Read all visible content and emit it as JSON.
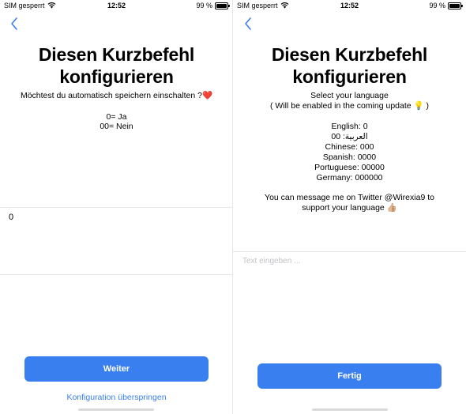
{
  "left": {
    "status": {
      "carrier": "SIM gesperrt",
      "time": "12:52",
      "battery": "99 %",
      "battery_level": 0.99
    },
    "back_icon": "chevron-left-icon",
    "title_line1": "Diesen Kurzbefehl",
    "title_line2": "konfigurieren",
    "question": "Möchtest du automatisch speichern einschalten ?",
    "question_emoji": "❤️",
    "option_yes": "0= Ja",
    "option_no": "00= Nein",
    "input_value": "0",
    "primary_button": "Weiter",
    "skip_link": "Konfiguration überspringen"
  },
  "right": {
    "status": {
      "carrier": "SIM gesperrt",
      "time": "12:52",
      "battery": "99 %",
      "battery_level": 0.99
    },
    "back_icon": "chevron-left-icon",
    "title_line1": "Diesen Kurzbefehl",
    "title_line2": "konfigurieren",
    "select_language": "Select your language",
    "coming_update": "( Will be enabled in the coming update 💡 )",
    "languages": [
      "English: 0",
      "العربية: 00",
      "Chinese: 000",
      "Spanish: 0000",
      "Portuguese: 00000",
      "Germany: 000000"
    ],
    "message_line1": "You can message me on Twitter @Wirexia9 to",
    "message_line2": "support your language 👍🏼",
    "input_placeholder": "Text eingeben ...",
    "primary_button": "Fertig"
  },
  "colors": {
    "accent": "#3a7ff0",
    "divider": "#e6e6e6",
    "placeholder": "#c3c3c7",
    "heart": "#e0303d"
  }
}
